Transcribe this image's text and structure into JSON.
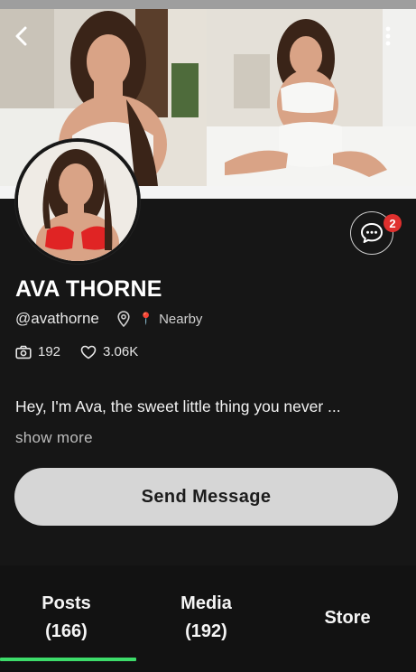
{
  "profile": {
    "name": "AVA THORNE",
    "handle": "@avathorne",
    "location_label": "Nearby",
    "stats": {
      "photos_count": "192",
      "likes_count": "3.06K"
    },
    "bio": "Hey, I'm Ava, the sweet little thing you never ...",
    "show_more_label": "show more"
  },
  "chat": {
    "badge_count": "2"
  },
  "actions": {
    "send_message_label": "Send Message"
  },
  "tabs": [
    {
      "label": "Posts",
      "count": "(166)"
    },
    {
      "label": "Media",
      "count": "(192)"
    },
    {
      "label": "Store",
      "count": ""
    }
  ],
  "colors": {
    "background": "#161616",
    "active_tab_underline": "#3ddc6a",
    "badge": "#e0302e",
    "send_button_bg": "#d6d6d6"
  },
  "icons": {
    "back": "chevron-left-icon",
    "more": "more-vertical-icon",
    "chat": "chat-bubble-icon",
    "location": "location-pin-icon",
    "photos": "camera-icon",
    "likes": "heart-icon"
  }
}
